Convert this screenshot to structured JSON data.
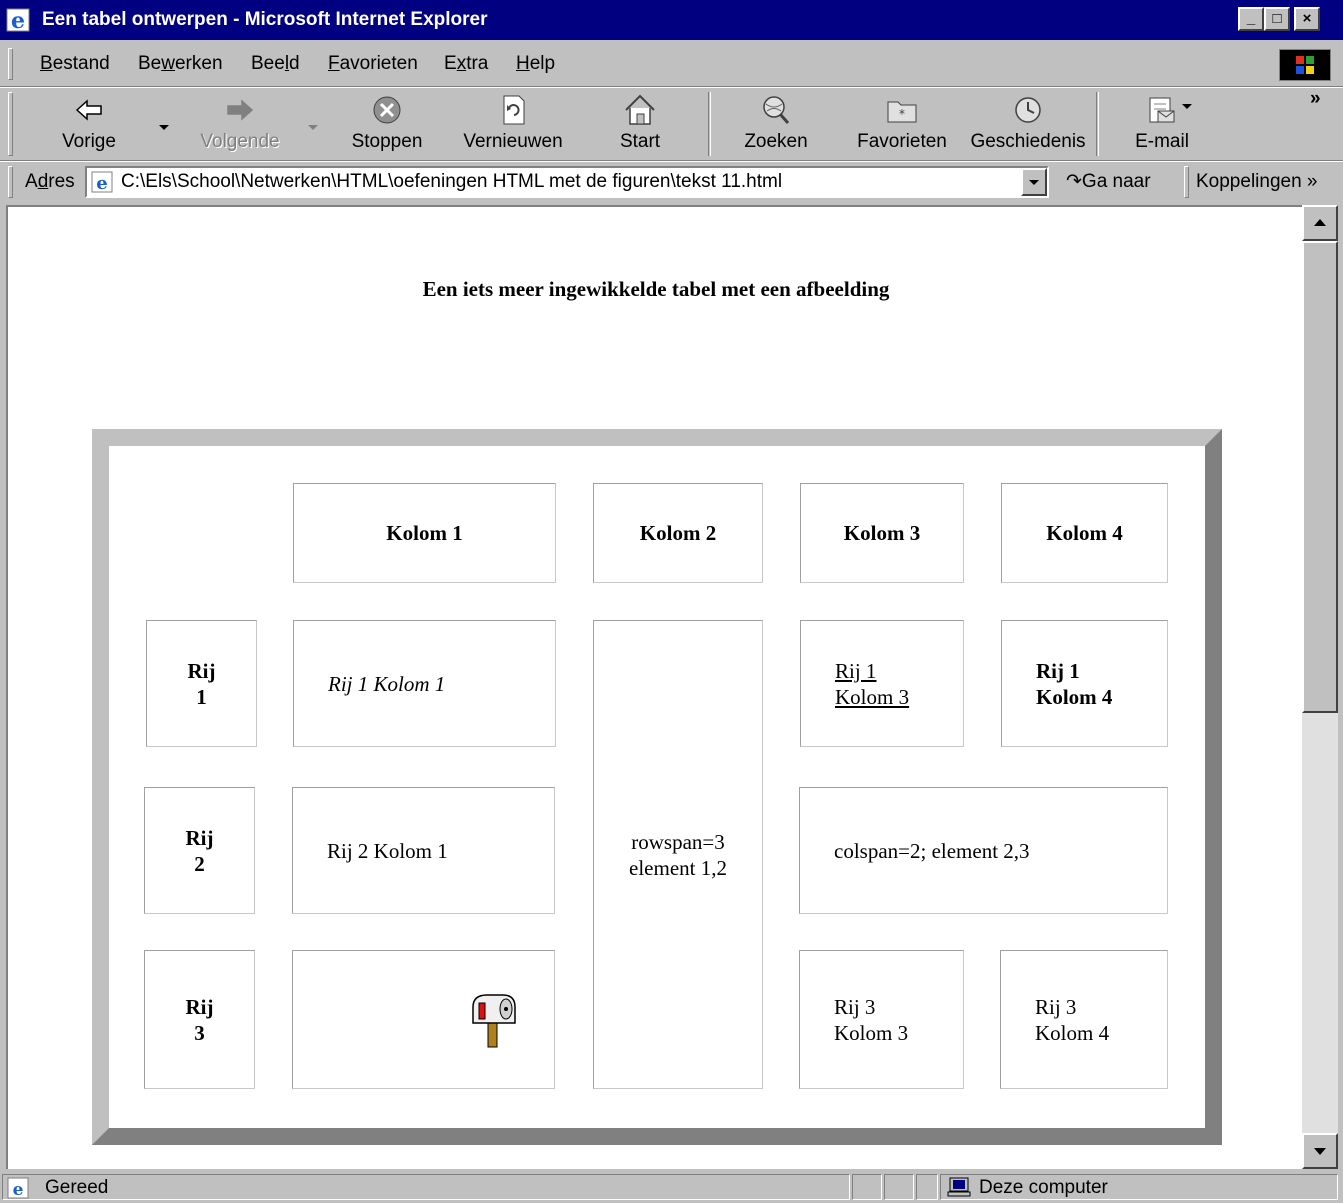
{
  "window": {
    "title": "Een tabel ontwerpen - Microsoft Internet Explorer",
    "minimize": "_",
    "maximize": "□",
    "close": "×"
  },
  "menu": [
    {
      "pre": "",
      "key": "B",
      "post": "estand"
    },
    {
      "pre": "Be",
      "key": "w",
      "post": "erken"
    },
    {
      "pre": "Bee",
      "key": "l",
      "post": "d"
    },
    {
      "pre": "",
      "key": "F",
      "post": "avorieten"
    },
    {
      "pre": "E",
      "key": "x",
      "post": "tra"
    },
    {
      "pre": "",
      "key": "H",
      "post": "elp"
    }
  ],
  "toolbar": {
    "back": "Vorige",
    "forward": "Volgende",
    "stop": "Stoppen",
    "refresh": "Vernieuwen",
    "home": "Start",
    "search": "Zoeken",
    "favorites": "Favorieten",
    "history": "Geschiedenis",
    "mail": "E-mail",
    "more": "»"
  },
  "address": {
    "label_pre": "A",
    "label_key": "d",
    "label_post": "res",
    "url": "C:\\Els\\School\\Netwerken\\HTML\\oefeningen HTML met de figuren\\tekst 11.html",
    "go": "Ga naar",
    "links": "Koppelingen »"
  },
  "content": {
    "heading": "Een iets meer ingewikkelde tabel met een afbeelding",
    "table": {
      "header": [
        "Kolom 1",
        "Kolom 2",
        "Kolom 3",
        "Kolom 4"
      ],
      "row_labels": [
        "Rij\n1",
        "Rij\n2",
        "Rij\n3"
      ],
      "r1c1": "Rij 1 Kolom 1",
      "rowspan": "rowspan=3\nelement 1,2",
      "r1c3": "Rij 1\nKolom 3",
      "r1c4": "Rij 1\nKolom 4",
      "r2c1": "Rij 2 Kolom 1",
      "colspan": "colspan=2; element 2,3",
      "r3c1_image": "mailbox-icon",
      "r3c3": "Rij 3\nKolom 3",
      "r3c4": "Rij 3\nKolom 4"
    }
  },
  "status": {
    "text": "Gereed",
    "zone": "Deze computer"
  }
}
